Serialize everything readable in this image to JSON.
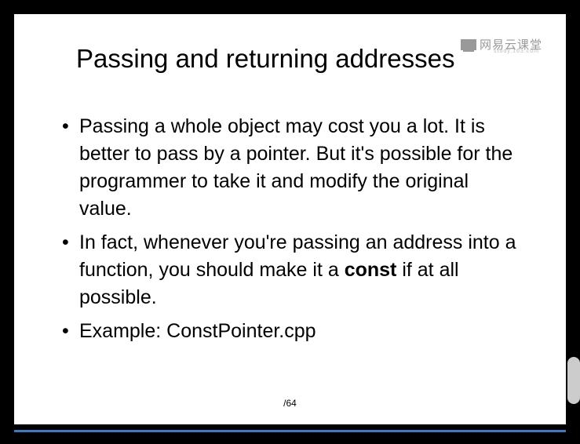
{
  "watermark": {
    "text": "网易云课堂",
    "subtext": "study.163.com"
  },
  "slide": {
    "title": "Passing and returning addresses",
    "bullets": [
      {
        "parts": [
          {
            "text": "Passing a whole object may cost you a lot. It is better to pass by a pointer.  But it's possible for the programmer to take it and modify the original value.",
            "bold": false
          }
        ]
      },
      {
        "parts": [
          {
            "text": "In fact, whenever you're passing an address into a function, you should make it a ",
            "bold": false
          },
          {
            "text": "const",
            "bold": true
          },
          {
            "text": " if at all possible.",
            "bold": false
          }
        ]
      },
      {
        "parts": [
          {
            "text": "Example: ConstPointer.cpp",
            "bold": false
          }
        ]
      }
    ],
    "page_indicator": "/64"
  }
}
